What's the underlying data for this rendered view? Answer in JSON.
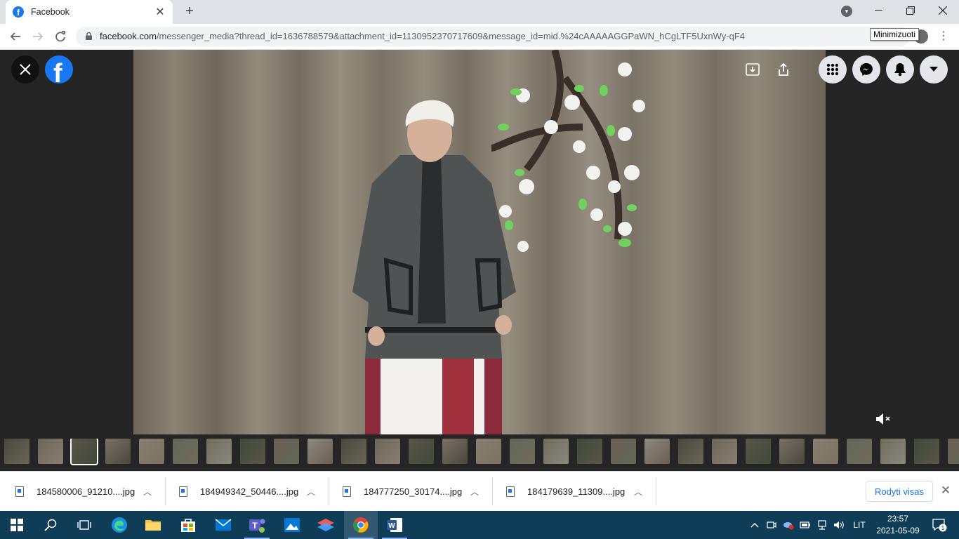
{
  "browser": {
    "tab_title": "Facebook",
    "favicon_letter": "f",
    "url_host": "facebook.com",
    "url_rest": "/messenger_media?thread_id=1636788579&attachment_id=1130952370717609&message_id=mid.%24cAAAAAGGPaWN_hCgLTF5UxnWy-qF4",
    "tooltip": "Minimizuoti"
  },
  "viewer": {
    "logo_letter": "f",
    "thumbnail_count": 29,
    "active_thumbnail": 2
  },
  "downloads": {
    "items": [
      {
        "name": "184580006_91210....jpg"
      },
      {
        "name": "184949342_50446....jpg"
      },
      {
        "name": "184777250_30174....jpg"
      },
      {
        "name": "184179639_11309....jpg"
      }
    ],
    "show_all_label": "Rodyti visas"
  },
  "taskbar": {
    "language": "LIT",
    "time": "23:57",
    "date": "2021-05-09",
    "notification_count": "1"
  },
  "colors": {
    "facebook_blue": "#1877f2",
    "taskbar": "#0f3d57",
    "link_blue": "#1a73e8"
  }
}
